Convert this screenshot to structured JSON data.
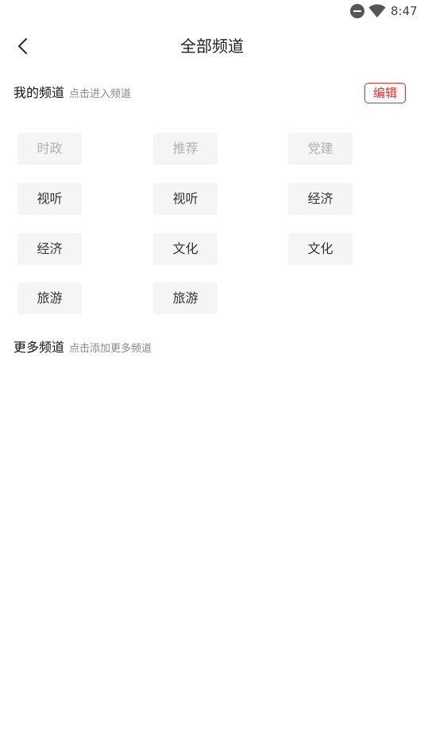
{
  "status_bar": {
    "time": "8:47",
    "icons": [
      "do-not-disturb-icon",
      "wifi-icon"
    ]
  },
  "header": {
    "title": "全部频道",
    "back_icon": "chevron-left-icon"
  },
  "my_channels": {
    "title": "我的频道",
    "hint": "点击进入频道",
    "edit_label": "编辑",
    "items": [
      {
        "label": "时政",
        "fixed": true
      },
      {
        "label": "推荐",
        "fixed": true
      },
      {
        "label": "党建",
        "fixed": true
      },
      {
        "label": "视听",
        "fixed": false
      },
      {
        "label": "视听",
        "fixed": false
      },
      {
        "label": "经济",
        "fixed": false
      },
      {
        "label": "经济",
        "fixed": false
      },
      {
        "label": "文化",
        "fixed": false
      },
      {
        "label": "文化",
        "fixed": false
      },
      {
        "label": "旅游",
        "fixed": false
      },
      {
        "label": "旅游",
        "fixed": false
      }
    ]
  },
  "more_channels": {
    "title": "更多频道",
    "hint": "点击添加更多频道"
  },
  "colors": {
    "accent": "#d8332a",
    "chip_bg": "#f5f5f5",
    "fixed_text": "#b0b0b0",
    "hint_text": "#8a8a8a"
  }
}
